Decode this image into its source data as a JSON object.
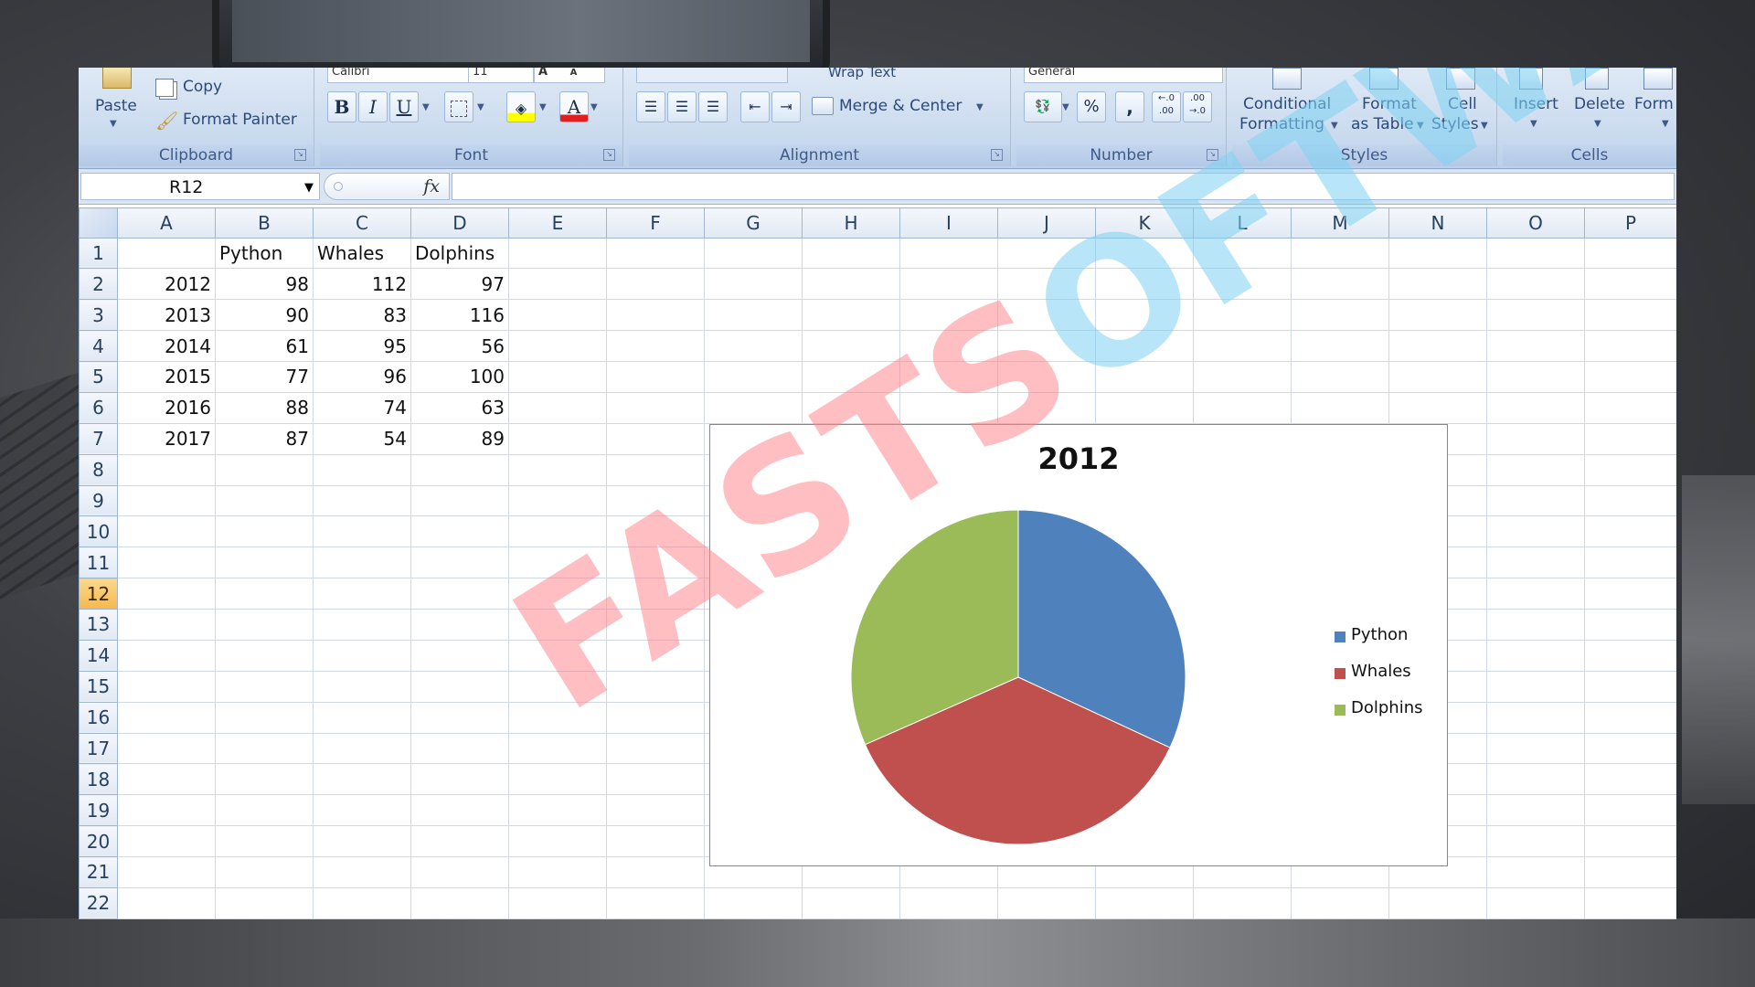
{
  "ribbon": {
    "clipboard": {
      "paste": "Paste",
      "copy": "Copy",
      "format_painter": "Format Painter",
      "label": "Clipboard"
    },
    "font": {
      "font_name": "Calibri",
      "font_size": "11",
      "bold": "B",
      "italic": "I",
      "underline": "U",
      "font_color_glyph": "A",
      "grow": "A",
      "shrink": "A",
      "label": "Font"
    },
    "alignment": {
      "wrap_text": "Wrap Text",
      "merge_center": "Merge & Center",
      "label": "Alignment"
    },
    "number": {
      "format": "General",
      "percent": "%",
      "comma": ",",
      "inc_decimal": "←.0 .00",
      "dec_decimal": ".00 →.0",
      "label": "Number"
    },
    "styles": {
      "conditional_1": "Conditional",
      "conditional_2": "Formatting",
      "format_table_1": "Format",
      "format_table_2": "as Table",
      "cell_styles_1": "Cell",
      "cell_styles_2": "Styles",
      "label": "Styles"
    },
    "cells": {
      "insert": "Insert",
      "delete": "Delete",
      "format": "Form",
      "label": "Cells"
    }
  },
  "formula_bar": {
    "name_box": "R12",
    "fx": "fx",
    "value": ""
  },
  "grid": {
    "columns": [
      "A",
      "B",
      "C",
      "D",
      "E",
      "F",
      "G",
      "H",
      "I",
      "J",
      "K",
      "L",
      "M",
      "N",
      "O",
      "P"
    ],
    "rows": [
      "1",
      "2",
      "3",
      "4",
      "5",
      "6",
      "7",
      "8",
      "9",
      "10",
      "11",
      "12",
      "13",
      "14",
      "15",
      "16",
      "17",
      "18",
      "19",
      "20",
      "21",
      "22"
    ],
    "active_row": "12",
    "headers": [
      "",
      "Python",
      "Whales",
      "Dolphins"
    ],
    "data": [
      [
        "2012",
        "98",
        "112",
        "97"
      ],
      [
        "2013",
        "90",
        "83",
        "116"
      ],
      [
        "2014",
        "61",
        "95",
        "56"
      ],
      [
        "2015",
        "77",
        "96",
        "100"
      ],
      [
        "2016",
        "88",
        "74",
        "63"
      ],
      [
        "2017",
        "87",
        "54",
        "89"
      ]
    ]
  },
  "chart_data": {
    "type": "pie",
    "title": "2012",
    "categories": [
      "Python",
      "Whales",
      "Dolphins"
    ],
    "values": [
      98,
      112,
      97
    ],
    "colors": [
      "#4f81bd",
      "#c0504d",
      "#9bbb59"
    ],
    "legend_position": "right"
  },
  "watermark": {
    "part1": "FASTS",
    "part2": "OFTWARES"
  }
}
